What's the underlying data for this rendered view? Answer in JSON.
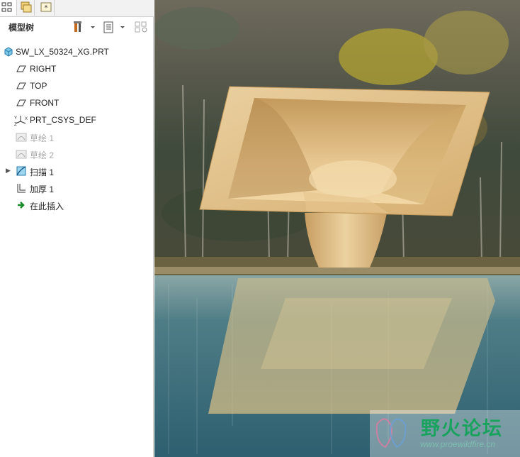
{
  "panel": {
    "title": "模型树"
  },
  "tree": {
    "items": [
      {
        "label": "SW_LX_50324_XG.PRT",
        "icon": "part-icon",
        "state": "normal"
      },
      {
        "label": "RIGHT",
        "icon": "datum-plane-icon",
        "state": "normal"
      },
      {
        "label": "TOP",
        "icon": "datum-plane-icon",
        "state": "normal"
      },
      {
        "label": "FRONT",
        "icon": "datum-plane-icon",
        "state": "normal"
      },
      {
        "label": "PRT_CSYS_DEF",
        "icon": "csys-icon",
        "state": "normal"
      },
      {
        "label": "草绘 1",
        "icon": "sketch-icon",
        "state": "dimmed"
      },
      {
        "label": "草绘 2",
        "icon": "sketch-icon",
        "state": "dimmed"
      },
      {
        "label": "扫描 1",
        "icon": "sweep-icon",
        "state": "normal",
        "expandable": true
      },
      {
        "label": "加厚 1",
        "icon": "thicken-icon",
        "state": "normal"
      },
      {
        "label": "在此插入",
        "icon": "insert-here-arrow-icon",
        "state": "normal"
      }
    ]
  },
  "watermark": {
    "title": "野火论坛",
    "url": "www.proewildfire.cn"
  },
  "colors": {
    "accent_green": "#1aa35e",
    "wood": "#dcb478",
    "water": "#3c7484"
  }
}
